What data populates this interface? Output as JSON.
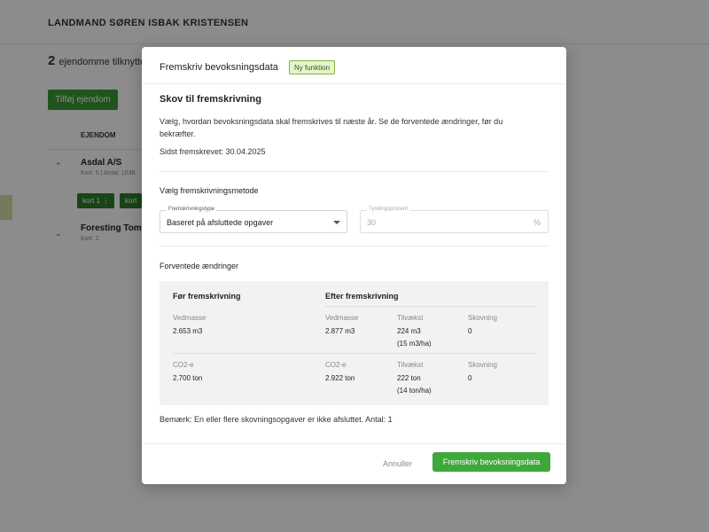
{
  "background": {
    "farmer_name": "LANDMAND SØREN ISBAK KRISTENSEN",
    "property_count": "2",
    "property_count_text": "ejendomme tilknyttet v",
    "add_property_label": "Tilføj ejendom",
    "column_header": "EJENDOM",
    "properties": [
      {
        "name": "Asdal A/S",
        "sub": "Kort: 5 | Antal: 1038",
        "expanded": true
      },
      {
        "name": "Foresting Tomor",
        "sub": "Kort: 1",
        "expanded": false
      }
    ],
    "chips": [
      "kort 1  ⋮",
      "kort"
    ]
  },
  "modal": {
    "title": "Fremskriv bevoksningsdata",
    "badge": "Ny funktion",
    "section_title": "Skov til fremskrivning",
    "description": "Vælg, hvordan bevoksningsdata skal fremskrives til næste år. Se de forventede ændringer, før du bekræfter.",
    "last_projected": "Sidst fremskrevet: 30.04.2025",
    "method_title": "Vælg fremskrivningsmetode",
    "type_field": {
      "legend": "Fremskrivningstype",
      "value": "Baseret på afsluttede opgaver"
    },
    "thinning_field": {
      "legend": "Tyndingsprocent",
      "value": "30",
      "unit": "%",
      "disabled": true
    },
    "changes_title": "Forventede ændringer",
    "changes": {
      "before_header": "Før fremskrivning",
      "after_header": "Efter fremskrivning",
      "rows": [
        {
          "label": "Vedmasse",
          "before": "2.653 m3",
          "after_label": "Vedmasse",
          "after": "2.877 m3",
          "growth_label": "Tilvækst",
          "growth": "224 m3",
          "growth_per_ha": "(15 m3/ha)",
          "felling_label": "Skovning",
          "felling": "0"
        },
        {
          "label": "CO2-e",
          "before": "2.700 ton",
          "after_label": "CO2-e",
          "after": "2.922 ton",
          "growth_label": "Tilvækst",
          "growth": "222 ton",
          "growth_per_ha": "(14 ton/ha)",
          "felling_label": "Skovning",
          "felling": "0"
        }
      ]
    },
    "note": "Bemærk: En eller flere skovningsopgaver er ikke afsluttet. Antal: 1",
    "cancel_label": "Annuller",
    "confirm_label": "Fremskriv bevoksningsdata"
  },
  "colors": {
    "primary": "#3fa83a",
    "badge_bg": "#e6f4c9",
    "overlay": "rgba(0,0,0,0.45)"
  }
}
